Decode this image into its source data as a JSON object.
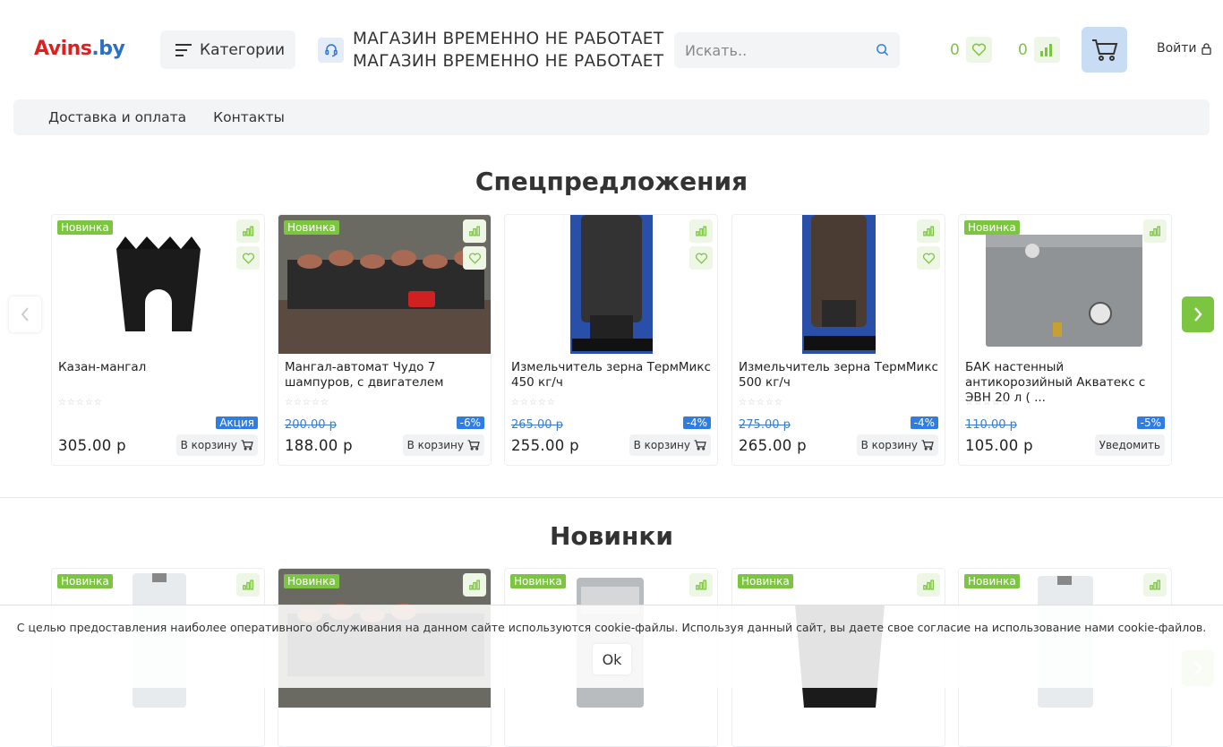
{
  "header": {
    "logo_part1": "Avins",
    "logo_part2": ".by",
    "categories_label": "Категории",
    "notice_line1": "МАГАЗИН ВРЕМЕННО НЕ РАБОТАЕТ",
    "notice_line2": "МАГАЗИН ВРЕМЕННО НЕ РАБОТАЕТ",
    "search_placeholder": "Искать..",
    "favorites_count": "0",
    "compare_count": "0",
    "login_label": "Войти"
  },
  "nav": {
    "items": [
      "Доставка и оплата",
      "Контакты"
    ]
  },
  "specials": {
    "title": "Спецпредложения",
    "products": [
      {
        "badge": "Новинка",
        "title": "Казан-мангал",
        "old_price": "",
        "discount": "",
        "promo": "Акция",
        "price": "305.00 р",
        "button": "В корзину"
      },
      {
        "badge": "Новинка",
        "title": "Мангал-автомат Чудо 7 шампуров, с двигателем",
        "old_price": "200.00 р",
        "discount": "-6%",
        "promo": "",
        "price": "188.00 р",
        "button": "В корзину"
      },
      {
        "badge": "",
        "title": "Измельчитель зерна ТермМикс 450 кг/ч",
        "old_price": "265.00 р",
        "discount": "-4%",
        "promo": "",
        "price": "255.00 р",
        "button": "В корзину"
      },
      {
        "badge": "",
        "title": "Измельчитель зерна ТермМикс 500 кг/ч",
        "old_price": "275.00 р",
        "discount": "-4%",
        "promo": "",
        "price": "265.00 р",
        "button": "В корзину"
      },
      {
        "badge": "Новинка",
        "title": "БАК настенный антикорозийный Акватекс с ЭВН 20 л ( ...",
        "old_price": "110.00 р",
        "discount": "-5%",
        "promo": "",
        "price": "105.00 р",
        "button": "Уведомить"
      }
    ]
  },
  "novelties": {
    "title": "Новинки",
    "badges": [
      "Новинка",
      "Новинка",
      "Новинка",
      "Новинка",
      "Новинка"
    ]
  },
  "cookie": {
    "text": "С целью предоставления наиболее оперативного обслуживания на данном сайте используются cookie-файлы. Используя данный сайт, вы даете свое согласие на использование нами cookie-файлов.",
    "ok_label": "Ok"
  },
  "colors": {
    "accent_green": "#7cc540",
    "accent_blue": "#2f7de1",
    "logo_red": "#e02020",
    "logo_blue": "#2a6fc9"
  }
}
